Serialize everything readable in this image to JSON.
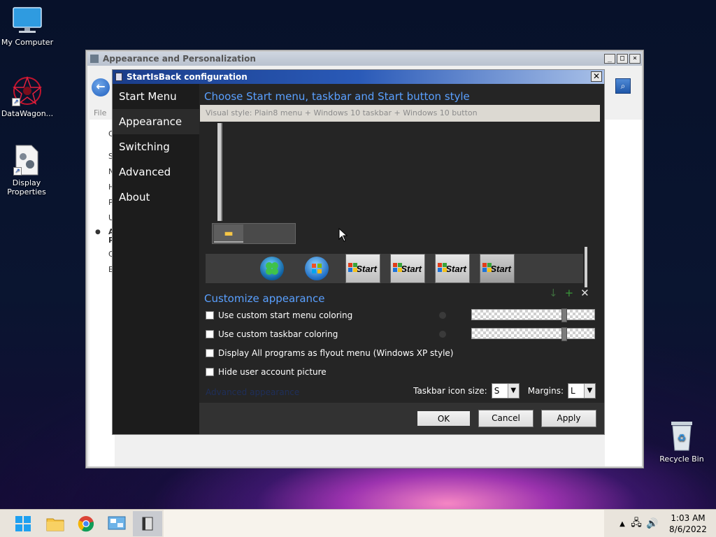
{
  "desktop": {
    "icons": [
      {
        "label": "My Computer"
      },
      {
        "label": "DataWagon..."
      },
      {
        "label": "Display Properties"
      },
      {
        "label": "Recycle Bin"
      }
    ]
  },
  "bg_window": {
    "title": "Appearance and Personalization",
    "menu_file": "File",
    "sidebar_letters": [
      "C",
      "S",
      "N",
      "H",
      "P",
      "U",
      "A",
      "P",
      "C",
      "E"
    ]
  },
  "dialog": {
    "title": "StartIsBack configuration",
    "nav": [
      "Start Menu",
      "Appearance",
      "Switching",
      "Advanced",
      "About"
    ],
    "heading": "Choose Start menu, taskbar and Start button style",
    "visual_style": "Visual style:  Plain8 menu + Windows 10 taskbar + Windows 10 button",
    "start_label": "Start",
    "customize_heading": "Customize appearance",
    "options": [
      "Use custom start menu coloring",
      "Use custom taskbar coloring",
      "Display All programs as flyout menu (Windows XP style)",
      "Hide user account picture"
    ],
    "dim_link": "Advanced appearance",
    "taskbar_icon_size_label": "Taskbar icon size:",
    "taskbar_icon_size_value": "S",
    "margins_label": "Margins:",
    "margins_value": "L",
    "buttons": {
      "ok": "OK",
      "cancel": "Cancel",
      "apply": "Apply"
    }
  },
  "taskbar": {
    "time": "1:03 AM",
    "date": "8/6/2022"
  }
}
